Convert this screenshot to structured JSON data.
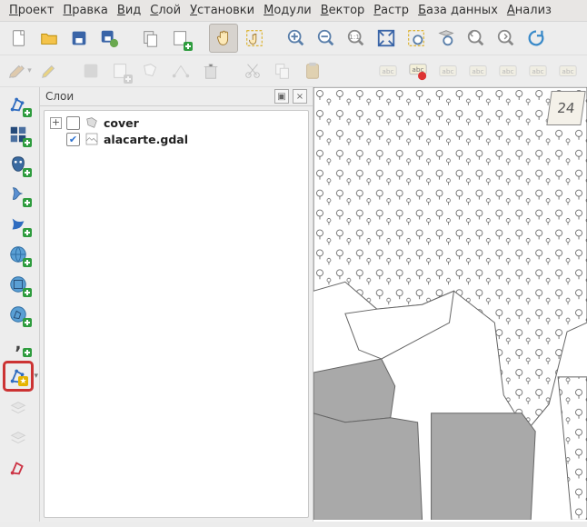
{
  "menubar": [
    {
      "hot": "П",
      "rest": "роект"
    },
    {
      "hot": "П",
      "rest": "равка"
    },
    {
      "hot": "В",
      "rest": "ид"
    },
    {
      "hot": "С",
      "rest": "лой"
    },
    {
      "hot": "У",
      "rest": "становки"
    },
    {
      "hot": "М",
      "rest": "одули"
    },
    {
      "hot": "В",
      "rest": "ектор"
    },
    {
      "hot": "Р",
      "rest": "астр"
    },
    {
      "hot": "Б",
      "rest": "аза данных"
    },
    {
      "hot": "А",
      "rest": "нализ"
    }
  ],
  "layers_panel": {
    "title": "Слои",
    "items": [
      {
        "id": "cover",
        "label": "cover",
        "checked": false,
        "expandable": true
      },
      {
        "id": "alacarte",
        "label": "alacarte.gdal",
        "checked": true,
        "child": true
      }
    ]
  },
  "compass_label": "24",
  "colors": {
    "accent": "#cc3333"
  }
}
